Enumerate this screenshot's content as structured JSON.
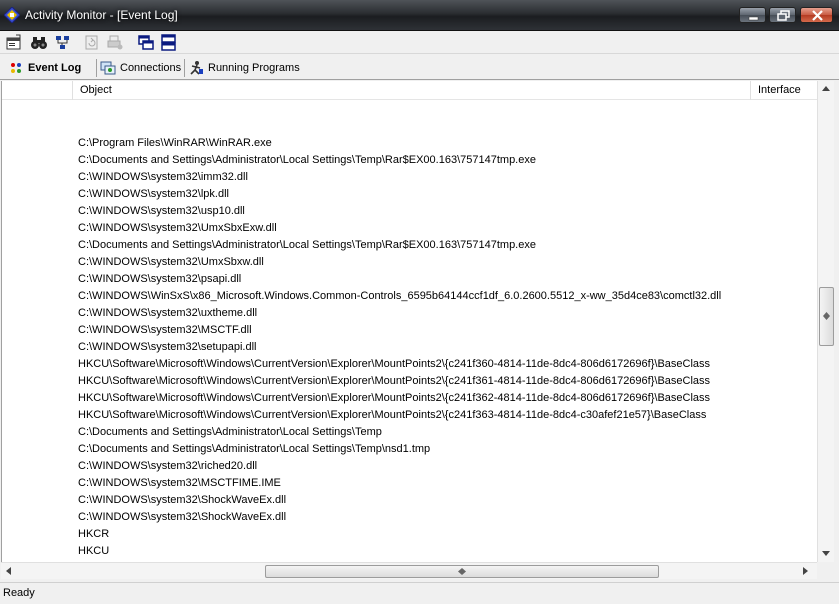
{
  "window": {
    "title": "Activity Monitor - [Event Log]"
  },
  "toolbar": {
    "buttons": [
      {
        "icon": "properties-icon"
      },
      {
        "icon": "find-binoculars-icon"
      },
      {
        "icon": "network-tree-icon"
      },
      {
        "icon": "refresh-disabled-icon"
      },
      {
        "icon": "print-disabled-icon"
      },
      {
        "icon": "cascade-windows-icon"
      },
      {
        "icon": "tile-windows-icon"
      }
    ]
  },
  "tabs": [
    {
      "label": "Event Log",
      "icon": "event-log-icon",
      "active": true
    },
    {
      "label": "Connections",
      "icon": "connections-icon",
      "active": false
    },
    {
      "label": "Running Programs",
      "icon": "running-programs-icon",
      "active": false
    }
  ],
  "list": {
    "columns": [
      "Object",
      "Interface"
    ],
    "rows": [
      "C:\\Program Files\\WinRAR\\WinRAR.exe",
      "C:\\Documents and Settings\\Administrator\\Local Settings\\Temp\\Rar$EX00.163\\757147tmp.exe",
      "C:\\WINDOWS\\system32\\imm32.dll",
      "C:\\WINDOWS\\system32\\lpk.dll",
      "C:\\WINDOWS\\system32\\usp10.dll",
      "C:\\WINDOWS\\system32\\UmxSbxExw.dll",
      "C:\\Documents and Settings\\Administrator\\Local Settings\\Temp\\Rar$EX00.163\\757147tmp.exe",
      "C:\\WINDOWS\\system32\\UmxSbxw.dll",
      "C:\\WINDOWS\\system32\\psapi.dll",
      "C:\\WINDOWS\\WinSxS\\x86_Microsoft.Windows.Common-Controls_6595b64144ccf1df_6.0.2600.5512_x-ww_35d4ce83\\comctl32.dll",
      "C:\\WINDOWS\\system32\\uxtheme.dll",
      "C:\\WINDOWS\\system32\\MSCTF.dll",
      "C:\\WINDOWS\\system32\\setupapi.dll",
      "HKCU\\Software\\Microsoft\\Windows\\CurrentVersion\\Explorer\\MountPoints2\\{c241f360-4814-11de-8dc4-806d6172696f}\\BaseClass",
      "HKCU\\Software\\Microsoft\\Windows\\CurrentVersion\\Explorer\\MountPoints2\\{c241f361-4814-11de-8dc4-806d6172696f}\\BaseClass",
      "HKCU\\Software\\Microsoft\\Windows\\CurrentVersion\\Explorer\\MountPoints2\\{c241f362-4814-11de-8dc4-806d6172696f}\\BaseClass",
      "HKCU\\Software\\Microsoft\\Windows\\CurrentVersion\\Explorer\\MountPoints2\\{c241f363-4814-11de-8dc4-c30afef21e57}\\BaseClass",
      "C:\\Documents and Settings\\Administrator\\Local Settings\\Temp",
      "C:\\Documents and Settings\\Administrator\\Local Settings\\Temp\\nsd1.tmp",
      "C:\\WINDOWS\\system32\\riched20.dll",
      "C:\\WINDOWS\\system32\\MSCTFIME.IME",
      "C:\\WINDOWS\\system32\\ShockWaveEx.dll",
      "C:\\WINDOWS\\system32\\ShockWaveEx.dll",
      "HKCR",
      "HKCU"
    ]
  },
  "status": {
    "text": "Ready"
  },
  "colors": {
    "titlebar": "#2a2d31",
    "window_bg": "#f0f0f0",
    "list_bg": "#ffffff",
    "close_button": "#c95b43"
  }
}
